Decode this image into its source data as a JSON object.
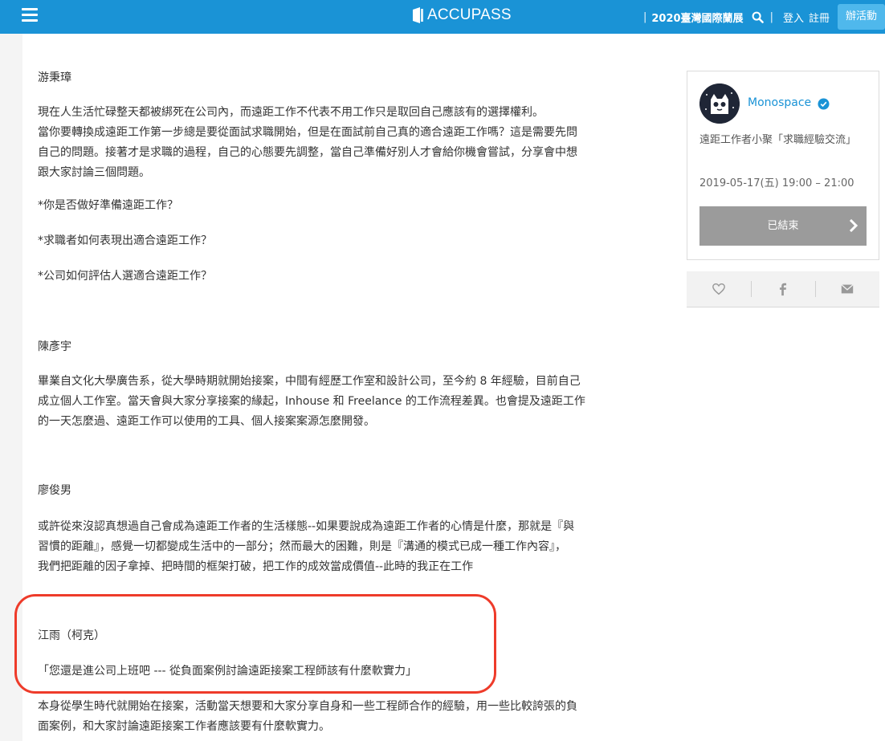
{
  "header": {
    "brand": "ACCUPASS",
    "event_link": "2020臺灣國際蘭展",
    "login": "登入",
    "register": "註冊",
    "create_event": "辦活動",
    "bar_color": "#1a93d6"
  },
  "article": {
    "paragraphs": [
      "游秉璋",
      "現在人生活忙碌整天都被綁死在公司內，而遠距工作不代表不用工作只是取回自己應該有的選擇權利。",
      "當你要轉換成遠距工作第一步總是要從面試求職開始，但是在面試前自己真的適合遠距工作嗎？這是需要先問",
      "自己的問題。接著才是求職的過程，自己的心態要先調整，當自己準備好別人才會給你機會嘗試，分享會中想",
      "跟大家討論三個問題。",
      "*你是否做好準備遠距工作？",
      "*求職者如何表現出適合遠距工作？",
      "*公司如何評估人選適合遠距工作？",
      "陳彥宇",
      "畢業自文化大學廣告系，從大學時期就開始接案，中間有經歷工作室和設計公司，至今約 8 年經驗，目前自己",
      "成立個人工作室。當天會與大家分享接案的緣起，Inhouse 和 Freelance 的工作流程差異。也會提及遠距工作",
      "的一天怎麼過、遠距工作可以使用的工具、個人接案案源怎麼開發。",
      "廖俊男",
      "或許從來沒認真想過自己會成為遠距工作者的生活樣態--如果要說成為遠距工作者的心情是什麼，那就是『與",
      "習慣的距離』，感覺一切都變成生活中的一部分；然而最大的困難，則是『溝通的模式已成一種工作內容』，",
      "我們把距離的因子拿掉、把時間的框架打破，把工作的成效當成價值--此時的我正在工作",
      "江雨（柯克）",
      "「您還是進公司上班吧 --- 從負面案例討論遠距接案工程師該有什麼軟實力」",
      "本身從學生時代就開始在接案，活動當天想要和大家分享自身和一些工程師合作的經驗，用一些比較誇張的負",
      "面案例，和大家討論遠距接案工作者應該要有什麼軟實力。"
    ],
    "highlight_color": "#ee3b2a"
  },
  "sidebar": {
    "organizer": "Monospace",
    "event_title": "遠距工作者小聚「求職經驗交流」",
    "event_date": "2019-05-17(五) 19:00 – 21:00",
    "status_button": "已結束"
  }
}
